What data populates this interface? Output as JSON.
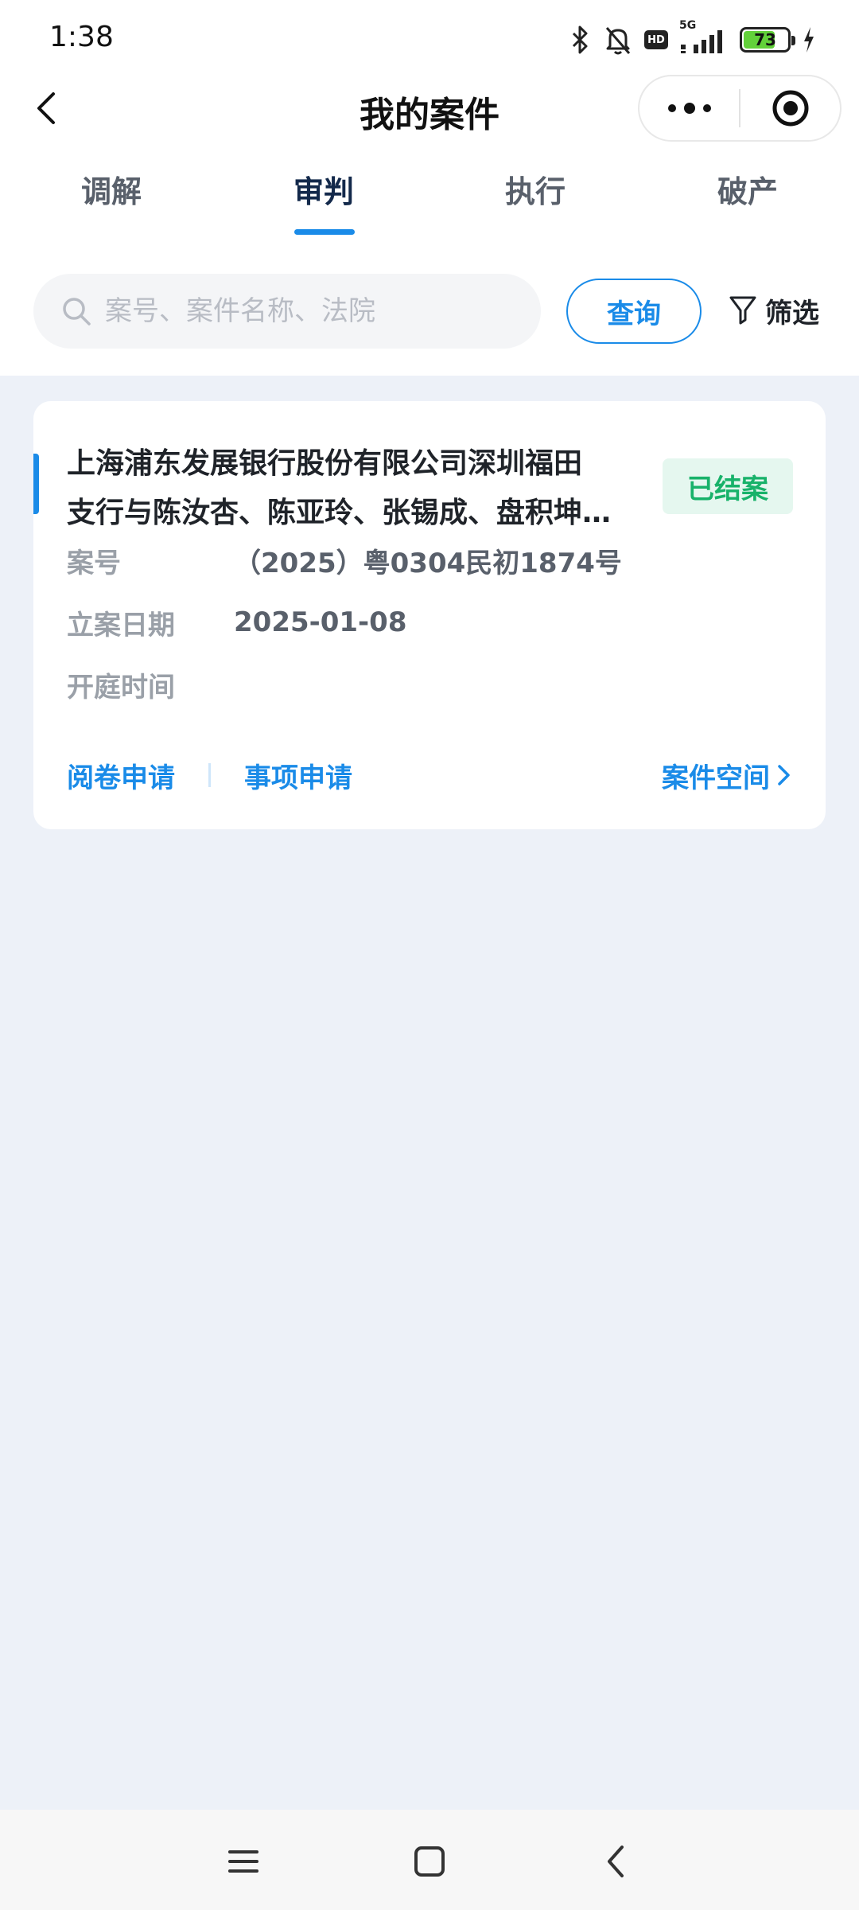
{
  "status_bar": {
    "time": "1:38",
    "battery_level": "73",
    "network": "5G",
    "hd_label": "HD",
    "icons": [
      "bluetooth-icon",
      "bell-off-icon",
      "hd-icon",
      "signal-icon",
      "battery-icon",
      "charging-icon"
    ]
  },
  "nav": {
    "title": "我的案件",
    "more_icon": "more-dots-icon",
    "target_icon": "target-icon"
  },
  "tabs": [
    {
      "label": "调解",
      "active": false
    },
    {
      "label": "审判",
      "active": true
    },
    {
      "label": "执行",
      "active": false
    },
    {
      "label": "破产",
      "active": false
    }
  ],
  "search": {
    "placeholder": "案号、案件名称、法院",
    "value": "",
    "query_label": "查询",
    "filter_label": "筛选"
  },
  "case": {
    "title_line1": "上海浦东发展银行股份有限公司深圳福田",
    "title_line2": "支行与陈汝杏、陈亚玲、张锡成、盘积坤…",
    "status": "已结案",
    "case_no_label": "案号",
    "case_no": "（2025）粤0304民初1874号",
    "filing_date_label": "立案日期",
    "filing_date": "2025-01-08",
    "hearing_label": "开庭时间",
    "hearing_time": "",
    "action_read": "阅卷申请",
    "action_matter": "事项申请",
    "action_space": "案件空间"
  },
  "colors": {
    "accent": "#1a8be8",
    "status_green": "#18b26a",
    "status_green_bg": "#e5f7ef",
    "page_bg": "#edf1f8"
  }
}
